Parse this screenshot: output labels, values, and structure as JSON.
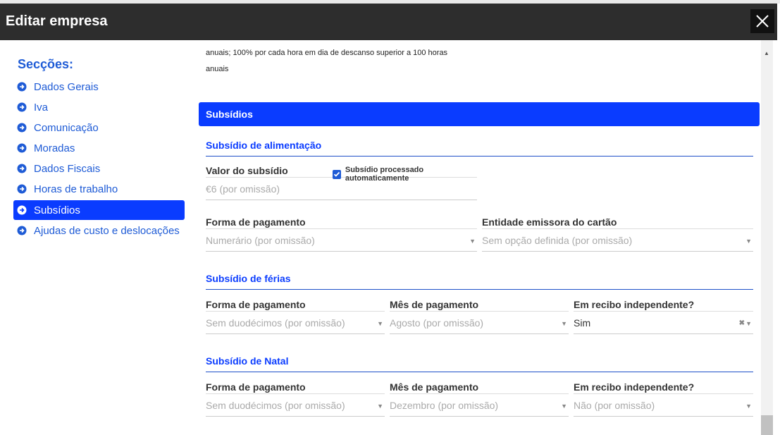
{
  "window": {
    "title": "Editar empresa"
  },
  "sidebar": {
    "heading": "Secções:",
    "items": [
      {
        "label": "Dados Gerais"
      },
      {
        "label": "Iva"
      },
      {
        "label": "Comunicação"
      },
      {
        "label": "Moradas"
      },
      {
        "label": "Dados Fiscais"
      },
      {
        "label": "Horas de trabalho"
      },
      {
        "label": "Subsídios",
        "active": true
      },
      {
        "label": "Ajudas de custo e deslocações"
      }
    ]
  },
  "content": {
    "note_line1": "anuais; 100% por cada hora em dia de descanso superior a 100 horas",
    "note_line2": "anuais",
    "section_title": "Subsídios",
    "alimentacao": {
      "title": "Subsídio de alimentação",
      "valor_label": "Valor do subsídio",
      "valor_value": "€6 (por omissão)",
      "auto_label": "Subsídio processado automaticamente",
      "auto_checked": true,
      "forma_label": "Forma de pagamento",
      "forma_value": "Numerário (por omissão)",
      "entidade_label": "Entidade emissora do cartão",
      "entidade_value": "Sem opção definida (por omissão)"
    },
    "ferias": {
      "title": "Subsídio de férias",
      "forma_label": "Forma de pagamento",
      "forma_value": "Sem duodécimos (por omissão)",
      "mes_label": "Mês de pagamento",
      "mes_value": "Agosto (por omissão)",
      "recibo_label": "Em recibo independente?",
      "recibo_value": "Sim"
    },
    "natal": {
      "title": "Subsídio de Natal",
      "forma_label": "Forma de pagamento",
      "forma_value": "Sem duodécimos (por omissão)",
      "mes_label": "Mês de pagamento",
      "mes_value": "Dezembro (por omissão)",
      "recibo_label": "Em recibo independente?",
      "recibo_value": "Não (por omissão)"
    }
  },
  "icons": {
    "close": "close-icon",
    "nav": "arrow-right-circle-icon",
    "caret": "caret-down-icon",
    "clear": "clear-icon",
    "scroll_up": "scroll-up-icon"
  },
  "colors": {
    "accent": "#0a3cff",
    "link": "#1e5bd6",
    "titlebar": "#2d2d2d"
  }
}
